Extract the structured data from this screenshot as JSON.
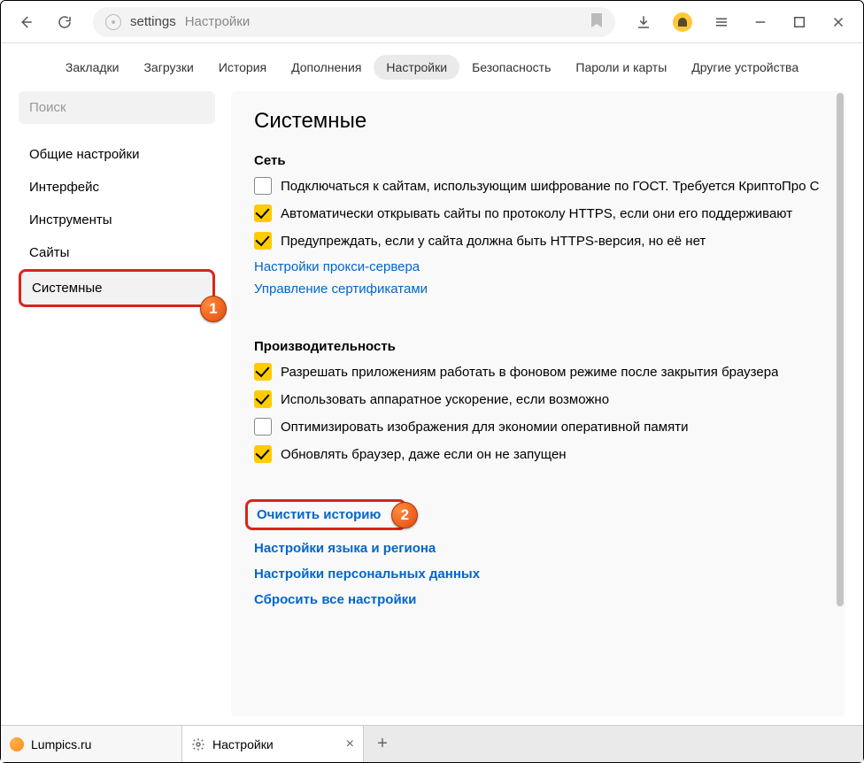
{
  "toolbar": {
    "addr_protocol": "settings",
    "addr_title": "Настройки"
  },
  "nav": {
    "items": [
      "Закладки",
      "Загрузки",
      "История",
      "Дополнения",
      "Настройки",
      "Безопасность",
      "Пароли и карты",
      "Другие устройства"
    ],
    "active_index": 4
  },
  "sidebar": {
    "search_placeholder": "Поиск",
    "items": [
      "Общие настройки",
      "Интерфейс",
      "Инструменты",
      "Сайты",
      "Системные"
    ],
    "active_index": 4
  },
  "main": {
    "heading": "Системные",
    "network": {
      "title": "Сеть",
      "rows": [
        {
          "checked": false,
          "label": "Подключаться к сайтам, использующим шифрование по ГОСТ. Требуется КриптоПро C"
        },
        {
          "checked": true,
          "label": "Автоматически открывать сайты по протоколу HTTPS, если они его поддерживают"
        },
        {
          "checked": true,
          "label": "Предупреждать, если у сайта должна быть HTTPS-версия, но её нет"
        }
      ],
      "links": [
        "Настройки прокси-сервера",
        "Управление сертификатами"
      ]
    },
    "performance": {
      "title": "Производительность",
      "rows": [
        {
          "checked": true,
          "label": "Разрешать приложениям работать в фоновом режиме после закрытия браузера"
        },
        {
          "checked": true,
          "label": "Использовать аппаратное ускорение, если возможно"
        },
        {
          "checked": false,
          "label": "Оптимизировать изображения для экономии оперативной памяти"
        },
        {
          "checked": true,
          "label": "Обновлять браузер, даже если он не запущен"
        }
      ]
    },
    "bottom_links": {
      "clear_history": "Очистить историю",
      "lang": "Настройки языка и региона",
      "personal": "Настройки персональных данных",
      "reset": "Сбросить все настройки"
    }
  },
  "annotations": {
    "badge1": "1",
    "badge2": "2"
  },
  "tabs": {
    "items": [
      {
        "label": "Lumpics.ru",
        "icon": "orange"
      },
      {
        "label": "Настройки",
        "icon": "gear"
      }
    ],
    "active_index": 1
  }
}
